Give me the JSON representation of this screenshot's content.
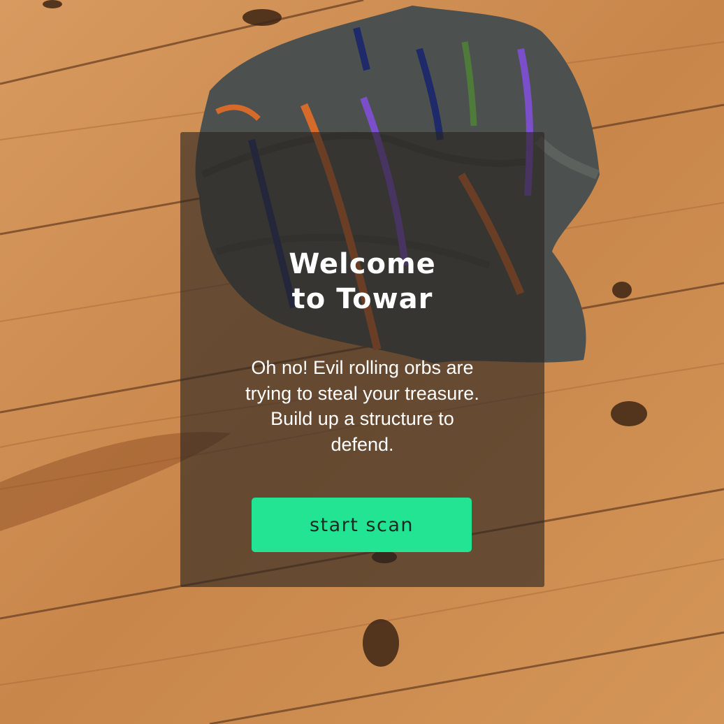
{
  "welcome": {
    "title_line1": "Welcome",
    "title_line2": "to Towar",
    "message_lines": [
      "Oh no!  Evil rolling orbs are",
      "trying to steal your treasure.",
      "Build up a structure to",
      "defend."
    ],
    "start_button_label": "start scan"
  },
  "colors": {
    "button_bg": "#22e493",
    "panel_bg": "rgba(40,36,33,0.62)",
    "floor_wood": "#c98a4e",
    "sweater": "#4b4f4d"
  }
}
